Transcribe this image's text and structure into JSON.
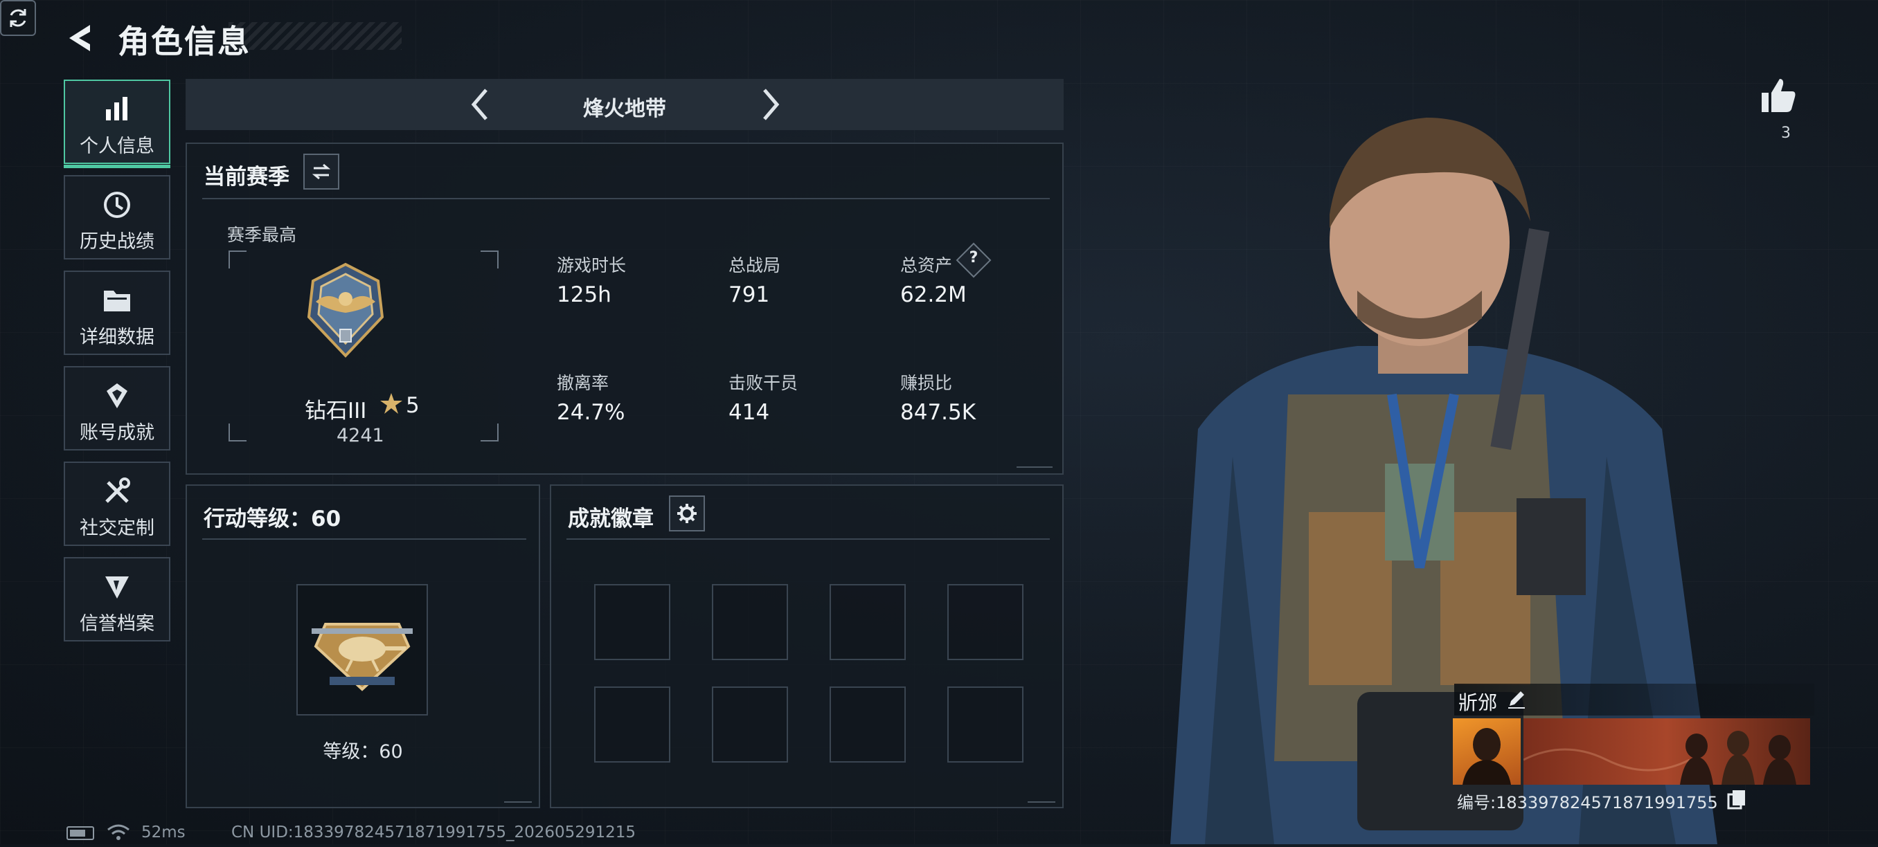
{
  "header": {
    "title": "角色信息"
  },
  "sidebar": {
    "items": [
      {
        "label": "个人信息",
        "icon": "bar-chart-icon",
        "active": true
      },
      {
        "label": "历史战绩",
        "icon": "history-icon"
      },
      {
        "label": "详细数据",
        "icon": "folder-icon"
      },
      {
        "label": "账号成就",
        "icon": "achievement-icon"
      },
      {
        "label": "社交定制",
        "icon": "tools-icon"
      },
      {
        "label": "信誉档案",
        "icon": "shield-icon"
      }
    ]
  },
  "season_selector": {
    "name": "烽火地带"
  },
  "current_season": {
    "title": "当前赛季",
    "best_label": "赛季最高",
    "rank_name": "钻石III",
    "rank_stars": "5",
    "rank_score": "4241",
    "stats": [
      {
        "label": "游戏时长",
        "value": "125h"
      },
      {
        "label": "总战局",
        "value": "791"
      },
      {
        "label": "总资产",
        "value": "62.2M",
        "help": "?"
      },
      {
        "label": "撤离率",
        "value": "24.7%"
      },
      {
        "label": "击败干员",
        "value": "414"
      },
      {
        "label": "赚损比",
        "value": "847.5K"
      }
    ]
  },
  "action_level": {
    "title": "行动等级：60",
    "level_label": "等级：60"
  },
  "achievement_badges": {
    "title": "成就徽章"
  },
  "profile": {
    "likes": "3",
    "name": "斨邠",
    "id_text": "编号:1833978245718719917​55"
  },
  "status_bar": {
    "ping": "52ms",
    "uid": "CN UID:183397824571871991755_202605291215"
  },
  "colors": {
    "accent": "#4fc8a2",
    "panel_border": "#36414c",
    "background": "#131a22"
  }
}
